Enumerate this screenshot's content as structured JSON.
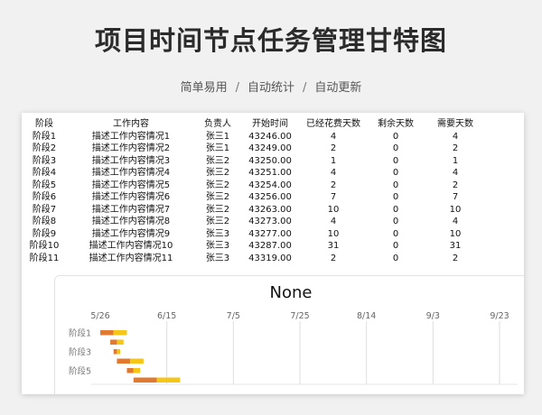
{
  "header": {
    "title": "项目时间节点任务管理甘特图",
    "features": [
      "简单易用",
      "自动统计",
      "自动更新"
    ],
    "separator": "/"
  },
  "table": {
    "columns": [
      "阶段",
      "工作内容",
      "负责人",
      "开始时间",
      "已经花费天数",
      "剩余天数",
      "需要天数"
    ],
    "rows": [
      [
        "阶段1",
        "描述工作内容情况1",
        "张三1",
        "43246.00",
        "4",
        "0",
        "4"
      ],
      [
        "阶段2",
        "描述工作内容情况2",
        "张三1",
        "43249.00",
        "2",
        "0",
        "2"
      ],
      [
        "阶段3",
        "描述工作内容情况3",
        "张三2",
        "43250.00",
        "1",
        "0",
        "1"
      ],
      [
        "阶段4",
        "描述工作内容情况4",
        "张三2",
        "43251.00",
        "4",
        "0",
        "4"
      ],
      [
        "阶段5",
        "描述工作内容情况5",
        "张三2",
        "43254.00",
        "2",
        "0",
        "2"
      ],
      [
        "阶段6",
        "描述工作内容情况6",
        "张三2",
        "43256.00",
        "7",
        "0",
        "7"
      ],
      [
        "阶段7",
        "描述工作内容情况7",
        "张三2",
        "43263.00",
        "10",
        "0",
        "10"
      ],
      [
        "阶段8",
        "描述工作内容情况8",
        "张三2",
        "43273.00",
        "4",
        "0",
        "4"
      ],
      [
        "阶段9",
        "描述工作内容情况9",
        "张三3",
        "43277.00",
        "10",
        "0",
        "10"
      ],
      [
        "阶段10",
        "描述工作内容情况10",
        "张三3",
        "43287.00",
        "31",
        "0",
        "31"
      ],
      [
        "阶段11",
        "描述工作内容情况11",
        "张三3",
        "43319.00",
        "2",
        "0",
        "2"
      ]
    ]
  },
  "chart_data": {
    "type": "bar",
    "orientation": "horizontal-stacked",
    "title": "None",
    "x_ticks": [
      "5/26",
      "6/15",
      "7/5",
      "7/25",
      "8/14",
      "9/3",
      "9/23"
    ],
    "xlim": [
      43246,
      43366
    ],
    "y_ticks_shown": [
      "阶段1",
      "阶段3",
      "阶段5"
    ],
    "categories_visible": [
      "阶段1",
      "阶段2",
      "阶段3",
      "阶段4",
      "阶段5",
      "阶段6"
    ],
    "series": [
      {
        "color": "#e07a30",
        "values": [
          4,
          2,
          1,
          4,
          2,
          7
        ]
      },
      {
        "color": "#f5c518",
        "values": [
          4,
          2,
          1,
          4,
          2,
          7
        ]
      }
    ],
    "start": [
      43246,
      43249,
      43250,
      43251,
      43254,
      43256
    ],
    "grid": true
  }
}
